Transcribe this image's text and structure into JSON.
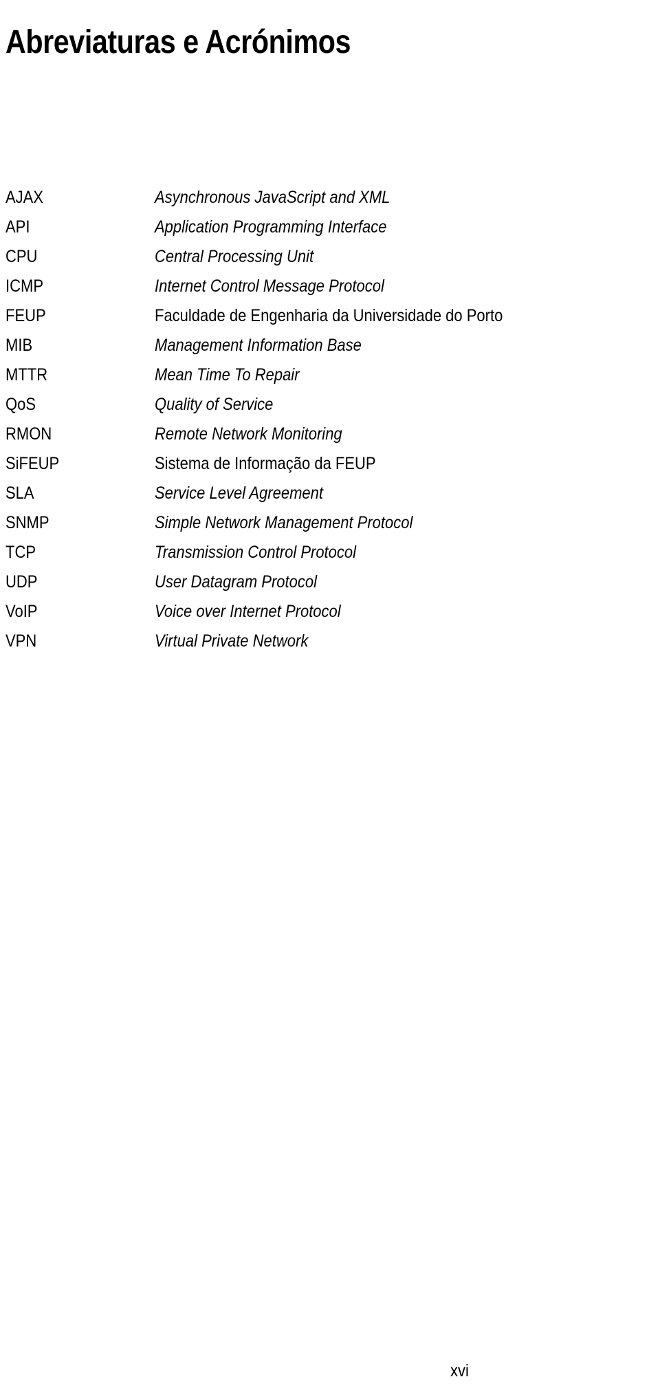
{
  "document": {
    "title": "Abreviaturas e Acrónimos",
    "folio": "xvi"
  },
  "abbreviations": [
    {
      "term": "AJAX",
      "definition": "Asynchronous JavaScript and XML",
      "language": "en"
    },
    {
      "term": "API",
      "definition": "Application Programming Interface",
      "language": "en"
    },
    {
      "term": "CPU",
      "definition": "Central Processing Unit",
      "language": "en"
    },
    {
      "term": "ICMP",
      "definition": "Internet Control Message Protocol",
      "language": "en"
    },
    {
      "term": "FEUP",
      "definition": "Faculdade de Engenharia da Universidade do Porto",
      "language": "pt"
    },
    {
      "term": "MIB",
      "definition": "Management Information Base",
      "language": "en"
    },
    {
      "term": "MTTR",
      "definition": "Mean Time To Repair",
      "language": "en"
    },
    {
      "term": "QoS",
      "definition": "Quality of Service",
      "language": "en"
    },
    {
      "term": "RMON",
      "definition": "Remote Network Monitoring",
      "language": "en"
    },
    {
      "term": "SiFEUP",
      "definition": "Sistema de Informação da FEUP",
      "language": "pt"
    },
    {
      "term": "SLA",
      "definition": "Service Level Agreement",
      "language": "en"
    },
    {
      "term": "SNMP",
      "definition": "Simple Network Management Protocol",
      "language": "en"
    },
    {
      "term": "TCP",
      "definition": "Transmission Control Protocol",
      "language": "en"
    },
    {
      "term": "UDP",
      "definition": "User Datagram Protocol",
      "language": "en"
    },
    {
      "term": "VoIP",
      "definition": "Voice over Internet Protocol",
      "language": "en"
    },
    {
      "term": "VPN",
      "definition": "Virtual Private Network",
      "language": "en"
    }
  ]
}
